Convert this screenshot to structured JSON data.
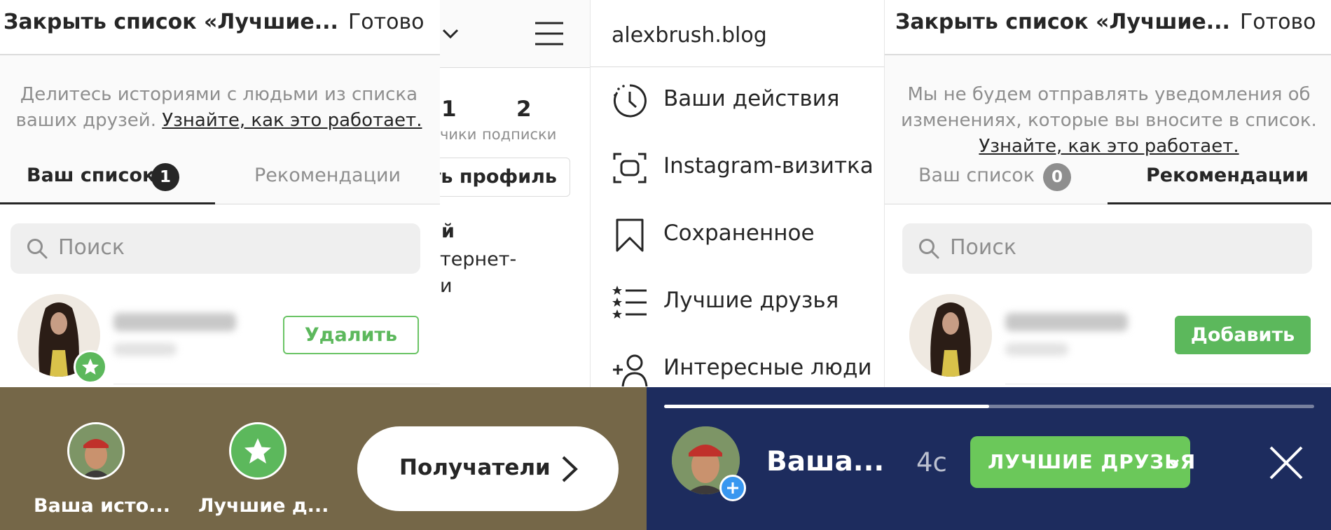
{
  "panel1": {
    "title": "Закрыть список «Лучшие...",
    "done": "Готово",
    "description_text": "Делитесь историями с людьми из списка ваших друзей. ",
    "description_link": "Узнайте, как это работает.",
    "tabs": [
      {
        "label": "Ваш список",
        "count": "1"
      },
      {
        "label": "Рекомендации"
      }
    ],
    "search_placeholder": "Поиск",
    "user_row": {
      "action": "Удалить"
    }
  },
  "panel2": {
    "stats": [
      {
        "value": "1",
        "label": "чики"
      },
      {
        "value": "2",
        "label": "подписки"
      }
    ],
    "edit_button": "ть профиль",
    "bio_lines": [
      "й",
      "тернет-",
      "и"
    ]
  },
  "panel3": {
    "username": "alexbrush.blog",
    "menu": [
      {
        "label": "Ваши действия",
        "icon": "activity-clock-icon"
      },
      {
        "label": "Instagram-визитка",
        "icon": "nametag-icon"
      },
      {
        "label": "Сохраненное",
        "icon": "bookmark-icon"
      },
      {
        "label": "Лучшие друзья",
        "icon": "close-friends-list-icon"
      },
      {
        "label": "Интересные люди",
        "icon": "add-person-icon"
      }
    ]
  },
  "panel4": {
    "title": "Закрыть список «Лучшие...",
    "done": "Готово",
    "description_text": "Мы не будем отправлять уведомления об изменениях, которые вы вносите в список.",
    "description_link": "Узнайте, как это работает.",
    "tabs": [
      {
        "label": "Ваш список",
        "count": "0"
      },
      {
        "label": "Рекомендации"
      }
    ],
    "search_placeholder": "Поиск",
    "user_row": {
      "action": "Добавить"
    }
  },
  "share_bar": {
    "items": [
      {
        "label": "Ваша исто..."
      },
      {
        "label": "Лучшие д..."
      }
    ],
    "recipients_button": "Получатели"
  },
  "story_bar": {
    "progress": 0.5,
    "title": "Ваша...",
    "time": "4с",
    "audience_button": "ЛУЧШИЕ ДРУЗЬЯ"
  },
  "colors": {
    "accent_green": "#5cb85c",
    "story_bg": "#1d2c5e",
    "share_bg": "#756748"
  }
}
